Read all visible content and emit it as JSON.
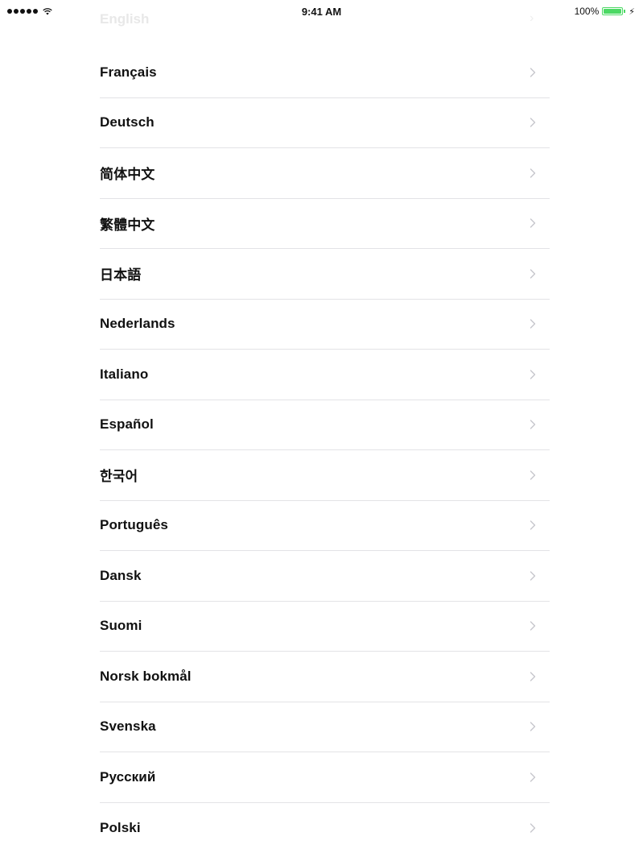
{
  "status_bar": {
    "time": "9:41 AM",
    "battery_percent": "100%",
    "battery_level": 1.0,
    "signal_bars": 5,
    "accent_color": "#4cd964"
  },
  "faded_item": {
    "label": "English"
  },
  "languages": [
    {
      "label": "Français"
    },
    {
      "label": "Deutsch"
    },
    {
      "label": "简体中文"
    },
    {
      "label": "繁體中文"
    },
    {
      "label": "日本語"
    },
    {
      "label": "Nederlands"
    },
    {
      "label": "Italiano"
    },
    {
      "label": "Español"
    },
    {
      "label": "한국어"
    },
    {
      "label": "Português"
    },
    {
      "label": "Dansk"
    },
    {
      "label": "Suomi"
    },
    {
      "label": "Norsk bokmål"
    },
    {
      "label": "Svenska"
    },
    {
      "label": "Русский"
    },
    {
      "label": "Polski"
    }
  ],
  "icons": {
    "row_chevron": "chevron-right-icon",
    "signal": "signal-dots-icon",
    "wifi": "wifi-icon",
    "battery": "battery-icon",
    "charging": "charging-bolt-icon"
  }
}
